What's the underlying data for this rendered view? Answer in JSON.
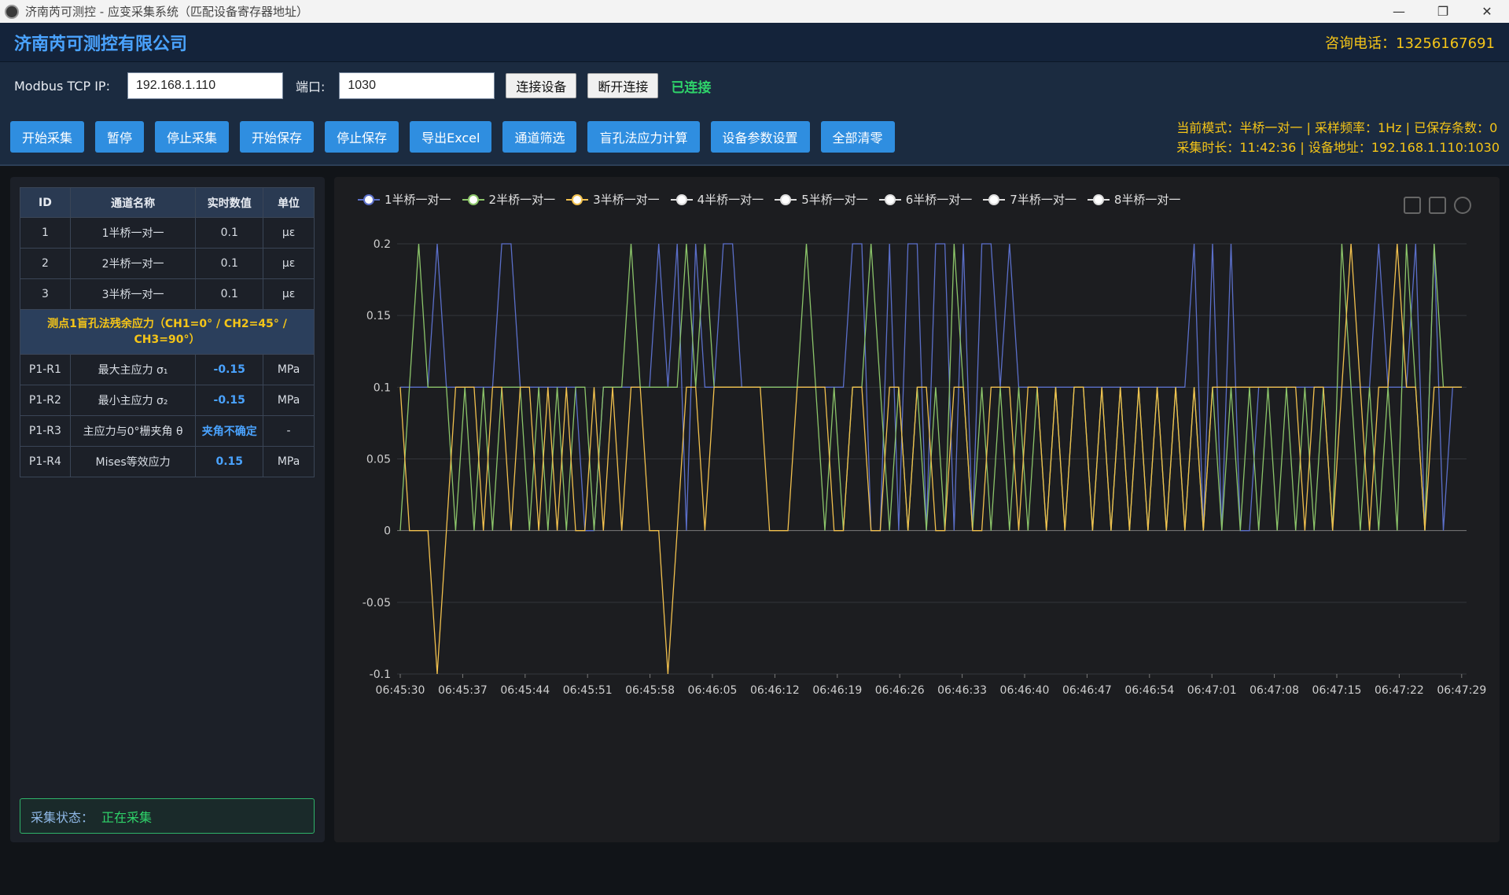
{
  "window": {
    "title": "济南芮可测控 - 应变采集系统（匹配设备寄存器地址）",
    "minimize": "—",
    "maximize": "❐",
    "close": "✕"
  },
  "header": {
    "company": "济南芮可测控有限公司",
    "phone": "咨询电话：13256167691"
  },
  "connection": {
    "ip_label": "Modbus TCP IP:",
    "ip_value": "192.168.1.110",
    "port_label": "端口:",
    "port_value": "1030",
    "connect_button": "连接设备",
    "disconnect_button": "断开连接",
    "status": "已连接"
  },
  "toolbar": {
    "buttons": [
      "开始采集",
      "暂停",
      "停止采集",
      "开始保存",
      "停止保存",
      "导出Excel",
      "通道筛选",
      "盲孔法应力计算",
      "设备参数设置",
      "全部清零"
    ],
    "info_line1": "当前模式：半桥一对一 | 采样频率：1Hz | 已保存条数：0",
    "info_line2": "采集时长：11:42:36 | 设备地址：192.168.1.110:1030"
  },
  "table": {
    "headers": [
      "ID",
      "通道名称",
      "实时数值",
      "单位"
    ],
    "rows": [
      {
        "id": "1",
        "name": "1半桥一对一",
        "value": "0.1",
        "unit": "με"
      },
      {
        "id": "2",
        "name": "2半桥一对一",
        "value": "0.1",
        "unit": "με"
      },
      {
        "id": "3",
        "name": "3半桥一对一",
        "value": "0.1",
        "unit": "με"
      }
    ],
    "section_title": "测点1盲孔法残余应力（CH1=0° / CH2=45° / CH3=90°）",
    "results": [
      {
        "id": "P1-R1",
        "name": "最大主应力 σ₁",
        "value": "-0.15",
        "unit": "MPa"
      },
      {
        "id": "P1-R2",
        "name": "最小主应力 σ₂",
        "value": "-0.15",
        "unit": "MPa"
      },
      {
        "id": "P1-R3",
        "name": "主应力与0°栅夹角 θ",
        "value": "夹角不确定",
        "unit": "-"
      },
      {
        "id": "P1-R4",
        "name": "Mises等效应力",
        "value": "0.15",
        "unit": "MPa"
      }
    ]
  },
  "acquisition": {
    "label": "采集状态：",
    "value": "正在采集"
  },
  "chart_data": {
    "type": "line",
    "legend": [
      {
        "name": "1半桥一对一",
        "color": "#5b6fc9"
      },
      {
        "name": "2半桥一对一",
        "color": "#8cc56a"
      },
      {
        "name": "3半桥一对一",
        "color": "#f2c14e"
      },
      {
        "name": "4半桥一对一",
        "color": "#dddddd"
      },
      {
        "name": "5半桥一对一",
        "color": "#dddddd"
      },
      {
        "name": "6半桥一对一",
        "color": "#dddddd"
      },
      {
        "name": "7半桥一对一",
        "color": "#dddddd"
      },
      {
        "name": "8半桥一对一",
        "color": "#dddddd"
      }
    ],
    "x_ticks": [
      "06:45:30",
      "06:45:37",
      "06:45:44",
      "06:45:51",
      "06:45:58",
      "06:46:05",
      "06:46:12",
      "06:46:19",
      "06:46:26",
      "06:46:33",
      "06:46:40",
      "06:46:47",
      "06:46:54",
      "06:47:01",
      "06:47:08",
      "06:47:15",
      "06:47:22",
      "06:47:29"
    ],
    "y_ticks": [
      "0.2",
      "0.15",
      "0.1",
      "0.05",
      "0",
      "-0.05",
      "-0.1"
    ],
    "ylim": [
      -0.1,
      0.2
    ],
    "series": [
      {
        "name": "1半桥一对一",
        "values": [
          0.1,
          0.1,
          0.1,
          0.1,
          0.2,
          0.1,
          0.1,
          0.1,
          0.1,
          0.1,
          0.1,
          0.2,
          0.2,
          0.1,
          0.1,
          0.1,
          0.1,
          0.1,
          0.1,
          0.1,
          0,
          0,
          0.1,
          0.1,
          0.1,
          0.1,
          0.1,
          0.1,
          0.2,
          0.1,
          0.2,
          0,
          0.2,
          0.1,
          0.1,
          0.2,
          0.2,
          0.1,
          0.1,
          0.1,
          0.1,
          0.1,
          0.1,
          0.1,
          0.1,
          0.1,
          0.1,
          0.1,
          0.1,
          0.2,
          0.2,
          0,
          0,
          0.2,
          0,
          0.2,
          0.2,
          0,
          0.2,
          0.2,
          0,
          0.2,
          0,
          0.2,
          0.2,
          0.1,
          0.2,
          0.1,
          0.1,
          0.1,
          0.1,
          0.1,
          0.1,
          0.1,
          0.1,
          0.1,
          0.1,
          0.1,
          0.1,
          0.1,
          0.1,
          0.1,
          0.1,
          0.1,
          0.1,
          0.1,
          0.2,
          0,
          0.2,
          0,
          0.2,
          0,
          0,
          0.1,
          0.1,
          0.1,
          0.1,
          0.1,
          0.1,
          0.1,
          0.1,
          0.1,
          0.1,
          0.1,
          0.1,
          0.1,
          0.2,
          0.1,
          0.1,
          0.1,
          0.2,
          0,
          0.2,
          0,
          0.1,
          0.1
        ]
      },
      {
        "name": "2半桥一对一",
        "values": [
          0,
          0.1,
          0.2,
          0.1,
          0.1,
          0.1,
          0,
          0.1,
          0,
          0.1,
          0,
          0.1,
          0.1,
          0.1,
          0,
          0.1,
          0,
          0.1,
          0,
          0.1,
          0.1,
          0,
          0.1,
          0.1,
          0.1,
          0.2,
          0.1,
          0.1,
          0.1,
          0.1,
          0.1,
          0.2,
          0.1,
          0.2,
          0.1,
          0.1,
          0.1,
          0.1,
          0.1,
          0.1,
          0.1,
          0.1,
          0.1,
          0.1,
          0.2,
          0.1,
          0,
          0.1,
          0,
          0.1,
          0.1,
          0.2,
          0.1,
          0,
          0.1,
          0,
          0.1,
          0,
          0.1,
          0,
          0.2,
          0.1,
          0,
          0.1,
          0,
          0.1,
          0,
          0.1,
          0,
          0.1,
          0,
          0.1,
          0,
          0.1,
          0.1,
          0,
          0.1,
          0,
          0.1,
          0,
          0.1,
          0,
          0.1,
          0,
          0.1,
          0,
          0.1,
          0,
          0.1,
          0,
          0.1,
          0,
          0.1,
          0,
          0.1,
          0,
          0.1,
          0,
          0.1,
          0,
          0.1,
          0,
          0.2,
          0.1,
          0,
          0.1,
          0,
          0.1,
          0,
          0.2,
          0.1,
          0,
          0.2,
          0.1,
          0.1,
          0.1
        ]
      },
      {
        "name": "3半桥一对一",
        "values": [
          0.1,
          0,
          0,
          0,
          -0.1,
          0,
          0.1,
          0.1,
          0.1,
          0,
          0.1,
          0.1,
          0,
          0.1,
          0.1,
          0,
          0.1,
          0,
          0.1,
          0,
          0,
          0.1,
          0,
          0.1,
          0,
          0.1,
          0.1,
          0,
          0,
          -0.1,
          0,
          0.1,
          0.1,
          0,
          0.1,
          0.1,
          0.1,
          0.1,
          0.1,
          0.1,
          0,
          0,
          0,
          0.1,
          0.1,
          0.1,
          0.1,
          0,
          0,
          0.1,
          0.1,
          0,
          0,
          0.1,
          0.1,
          0,
          0.1,
          0.1,
          0,
          0,
          0.1,
          0.1,
          0,
          0,
          0.1,
          0.1,
          0.1,
          0,
          0.1,
          0.1,
          0,
          0.1,
          0,
          0.1,
          0.1,
          0,
          0.1,
          0,
          0.1,
          0,
          0.1,
          0,
          0.1,
          0,
          0.1,
          0,
          0.1,
          0,
          0.1,
          0.1,
          0.1,
          0.1,
          0.1,
          0.1,
          0.1,
          0.1,
          0.1,
          0.1,
          0,
          0.1,
          0.1,
          0,
          0.1,
          0.2,
          0.1,
          0,
          0.1,
          0.1,
          0.2,
          0.1,
          0.1,
          0,
          0.1,
          0.1,
          0.1,
          0.1
        ]
      }
    ]
  }
}
